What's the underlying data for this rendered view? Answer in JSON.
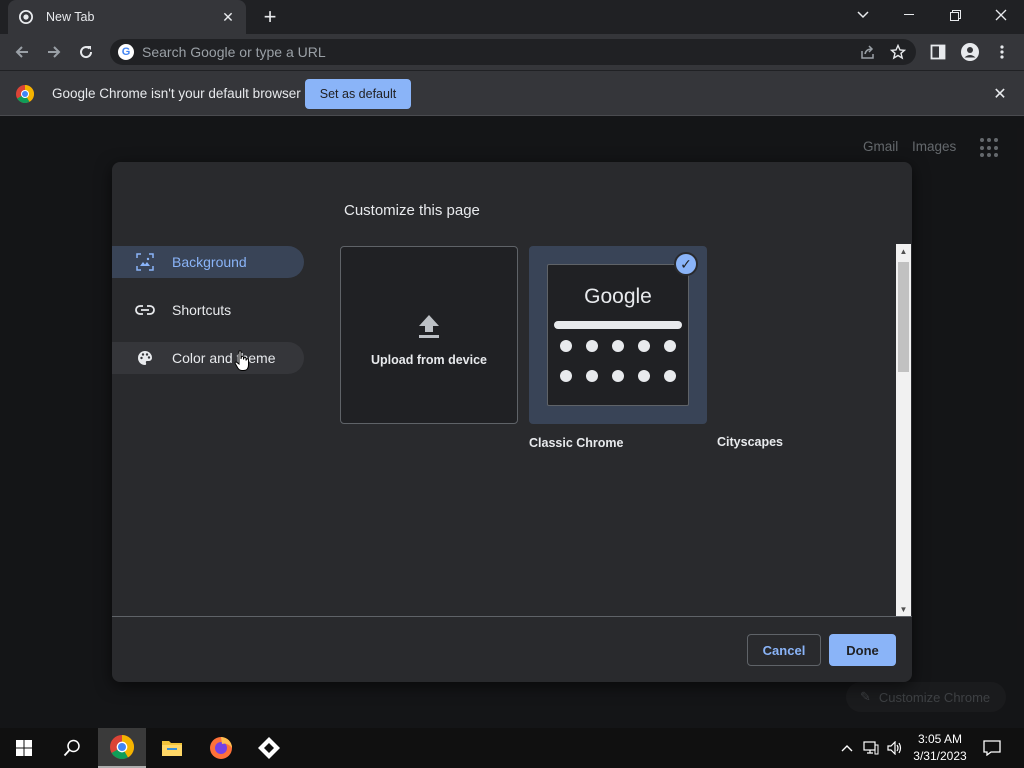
{
  "browser": {
    "tab_title": "New Tab",
    "omnibox_placeholder": "Search Google or type a URL"
  },
  "infobar": {
    "message": "Google Chrome isn't your default browser",
    "set_default_label": "Set as default"
  },
  "ntp": {
    "links": [
      "Gmail",
      "Images"
    ],
    "customize_chrome_label": "Customize Chrome"
  },
  "dialog": {
    "title": "Customize this page",
    "menu": [
      {
        "label": "Background",
        "icon": "image-icon",
        "selected": true
      },
      {
        "label": "Shortcuts",
        "icon": "link-icon",
        "selected": false
      },
      {
        "label": "Color and theme",
        "icon": "palette-icon",
        "selected": false
      }
    ],
    "tiles": {
      "upload_label": "Upload from device",
      "classic_label": "Classic Chrome",
      "classic_logo": "Google",
      "cityscapes_label": "Cityscapes"
    },
    "cancel_label": "Cancel",
    "done_label": "Done"
  },
  "taskbar": {
    "time": "3:05 AM",
    "date": "3/31/2023"
  },
  "colors": {
    "accent": "#8ab4f8",
    "background": "#202124",
    "surface": "#292a2d",
    "toolbar": "#35363a"
  }
}
